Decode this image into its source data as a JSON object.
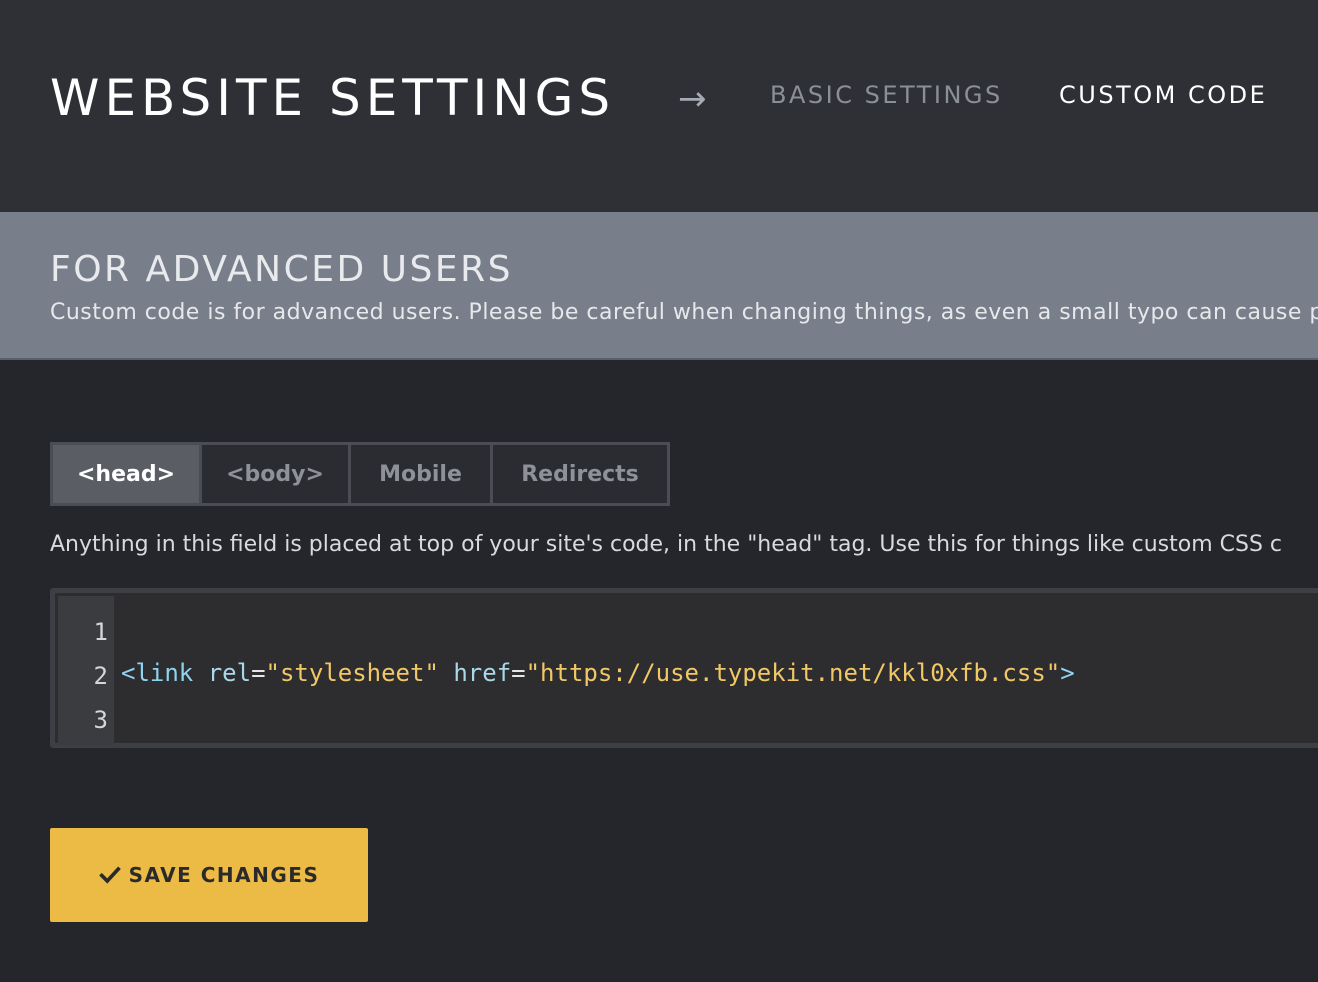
{
  "header": {
    "title": "WEBSITE SETTINGS",
    "arrow_glyph": "→",
    "nav": [
      {
        "label": "BASIC SETTINGS",
        "active": false
      },
      {
        "label": "CUSTOM CODE",
        "active": true
      }
    ]
  },
  "notice": {
    "title": "FOR ADVANCED USERS",
    "description": "Custom code is for advanced users. Please be careful when changing things, as even a small typo can cause pr"
  },
  "tabs": [
    {
      "label": "<head>",
      "active": true
    },
    {
      "label": "<body>",
      "active": false
    },
    {
      "label": "Mobile",
      "active": false
    },
    {
      "label": "Redirects",
      "active": false
    }
  ],
  "field_help": "Anything in this field is placed at top of your site's code, in the \"head\" tag. Use this for things like custom CSS c",
  "editor": {
    "line_numbers": [
      "1",
      "2",
      "3"
    ],
    "lines": [
      "",
      "<link rel=\"stylesheet\" href=\"https://use.typekit.net/kkl0xfb.css\">",
      ""
    ],
    "tokens_line2": {
      "open": "<link",
      "attr1": "rel",
      "eq1": "=",
      "val1": "\"stylesheet\"",
      "attr2": "href",
      "eq2": "=",
      "val2": "\"https://use.typekit.net/kkl0xfb.css\"",
      "close": ">"
    }
  },
  "save_button": {
    "label": "SAVE CHANGES",
    "icon": "check-icon"
  },
  "colors": {
    "header_bg": "#2e3036",
    "notice_bg": "#787f8a",
    "body_bg": "#24262b",
    "accent": "#ebbb45",
    "code_string": "#f2c866",
    "code_tag": "#8fd3f0"
  }
}
